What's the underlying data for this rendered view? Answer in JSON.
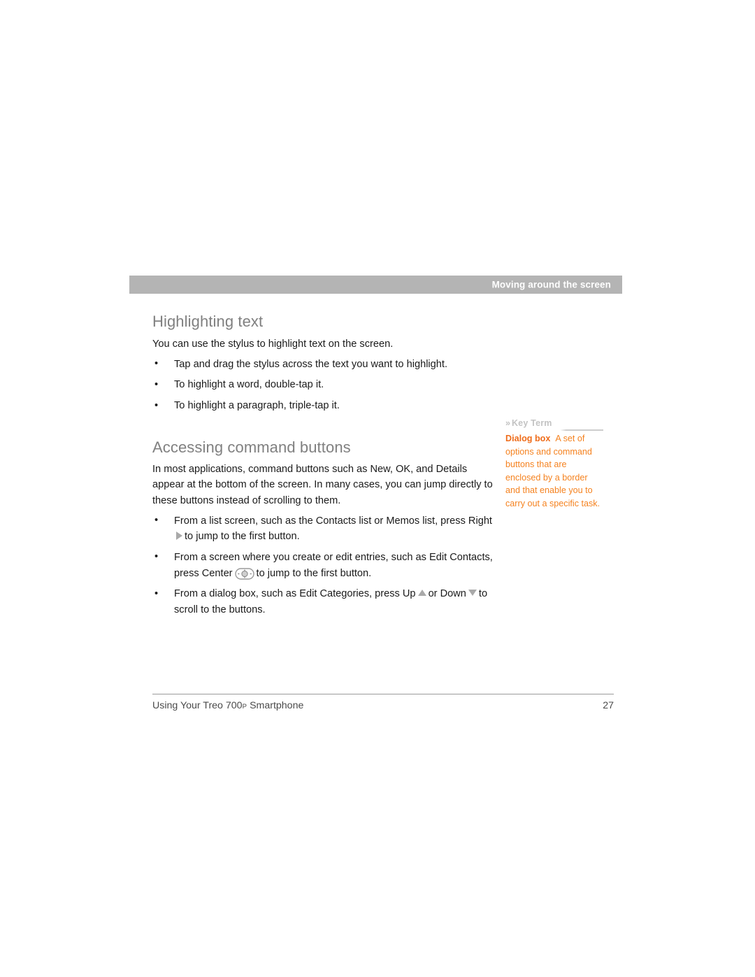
{
  "header": {
    "running_title": "Moving around the screen",
    "band_color": "#b4b4b4"
  },
  "sections": [
    {
      "heading": "Highlighting text",
      "intro": "You can use the stylus to highlight text on the screen.",
      "bullets": [
        "Tap and drag the stylus across the text you want to highlight.",
        "To highlight a word, double-tap it.",
        "To highlight a paragraph, triple-tap it."
      ]
    },
    {
      "heading": "Accessing command buttons",
      "intro": "In most applications, command buttons such as New, OK, and Details appear at the bottom of the screen. In many cases, you can jump directly to these buttons instead of scrolling to them.",
      "bullets": [
        {
          "part_1": "From a list screen, such as the Contacts list or Memos list, press Right",
          "glyph_1": "right-arrow-key-icon",
          "part_2": "to jump to the first button."
        },
        {
          "part_1": "From a screen where you create or edit entries, such as Edit Contacts, press Center",
          "glyph_1": "center-key-icon",
          "part_2": "to jump to the first button."
        },
        {
          "part_1": "From a dialog box, such as Edit Categories, press Up",
          "glyph_1": "up-arrow-key-icon",
          "part_2": "or Down",
          "glyph_2": "down-arrow-key-icon",
          "part_3": "to scroll to the buttons."
        }
      ]
    }
  ],
  "key_term": {
    "label_chevron": "»",
    "label": "Key Term",
    "term": "Dialog box",
    "definition": "A set of options and command buttons that are enclosed by a border and that enable you to carry out a specific task.",
    "color": "#f5821f",
    "label_color": "#c3c3c3"
  },
  "footer": {
    "title_before": "Using Your Treo 700",
    "title_sub": "P",
    "title_after": " Smartphone",
    "page_number": "27"
  }
}
